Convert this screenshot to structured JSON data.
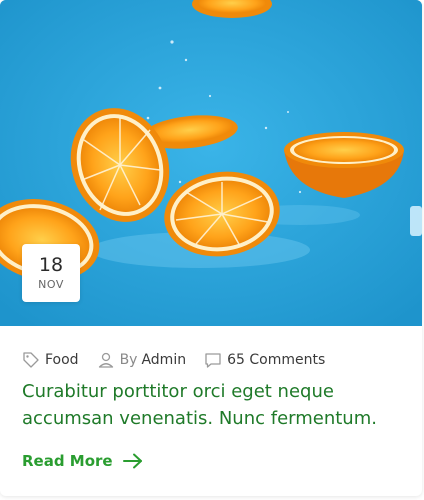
{
  "post": {
    "date": {
      "day": "18",
      "month": "NOV"
    },
    "meta": {
      "category": "Food",
      "author_prefix": "By",
      "author": "Admin",
      "comments": "65 Comments"
    },
    "title": "Curabitur porttitor orci eget neque accumsan venenatis. Nunc fermentum.",
    "read_more": "Read More"
  },
  "icons": [
    "tag-icon",
    "user-icon",
    "comment-icon",
    "arrow-right-icon"
  ],
  "colors": {
    "image_background": "#2fa8de",
    "title": "#1f7a29",
    "read_more": "#2a9d30",
    "meta_text": "#3a3a3a"
  }
}
